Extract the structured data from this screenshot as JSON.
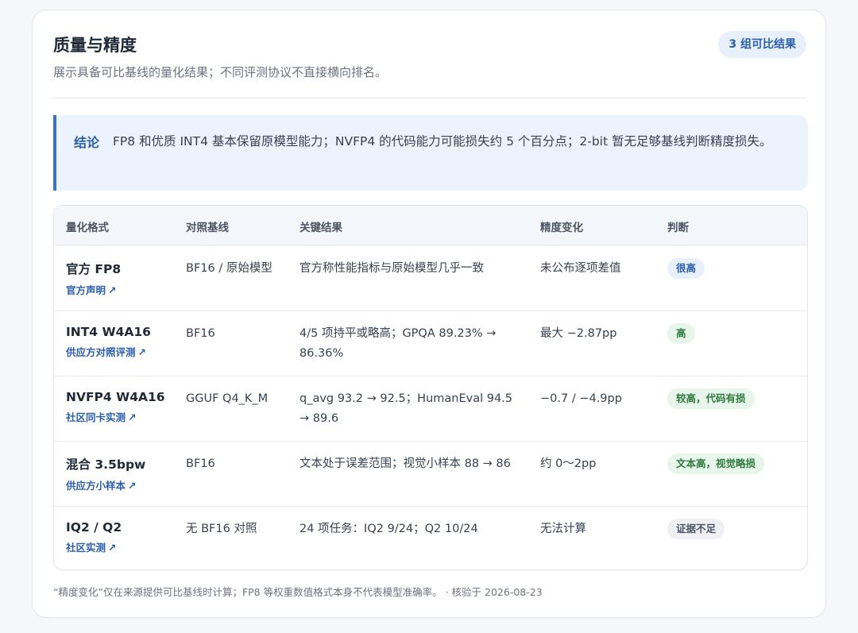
{
  "header": {
    "title": "质量与精度",
    "subtitle": "展示具备可比基线的量化结果；不同评测协议不直接横向排名。",
    "count_badge": "3 组可比结果"
  },
  "conclusion": {
    "label": "结论",
    "text": "FP8 和优质 INT4 基本保留原模型能力；NVFP4 的代码能力可能损失约 5 个百分点；2-bit 暂无足够基线判断精度损失。"
  },
  "table": {
    "headers": [
      "量化格式",
      "对照基线",
      "关键结果",
      "精度变化",
      "判断"
    ],
    "rows": [
      {
        "format": "官方 FP8",
        "source": "官方声明",
        "baseline": "BF16 / 原始模型",
        "result": "官方称性能指标与原始模型几乎一致",
        "change": "未公布逐项差值",
        "verdict": "很高",
        "verdict_tone": "blue"
      },
      {
        "format": "INT4 W4A16",
        "source": "供应方对照评测",
        "baseline": "BF16",
        "result": "4/5 项持平或略高；GPQA 89.23% → 86.36%",
        "change": "最大 −2.87pp",
        "verdict": "高",
        "verdict_tone": "green"
      },
      {
        "format": "NVFP4 W4A16",
        "source": "社区同卡实测",
        "baseline": "GGUF Q4_K_M",
        "result": "q_avg 93.2 → 92.5；HumanEval 94.5 → 89.6",
        "change": "−0.7 / −4.9pp",
        "verdict": "较高，代码有损",
        "verdict_tone": "green"
      },
      {
        "format": "混合 3.5bpw",
        "source": "供应方小样本",
        "baseline": "BF16",
        "result": "文本处于误差范围；视觉小样本 88 → 86",
        "change": "约 0～2pp",
        "verdict": "文本高，视觉略损",
        "verdict_tone": "green"
      },
      {
        "format": "IQ2 / Q2",
        "source": "社区实测",
        "baseline": "无 BF16 对照",
        "result": "24 项任务：IQ2 9/24；Q2 10/24",
        "change": "无法计算",
        "verdict": "证据不足",
        "verdict_tone": "gray"
      }
    ],
    "link_arrow": "↗"
  },
  "footnote": "“精度变化”仅在来源提供可比基线时计算；FP8 等权重数值格式本身不代表模型准确率。 · 核验于 2026-08-23",
  "colors": {
    "accent": "#2b5fab",
    "verdict_blue": "#e8f0fb",
    "verdict_green": "#e7f5ea",
    "verdict_gray": "#eef0f3"
  }
}
